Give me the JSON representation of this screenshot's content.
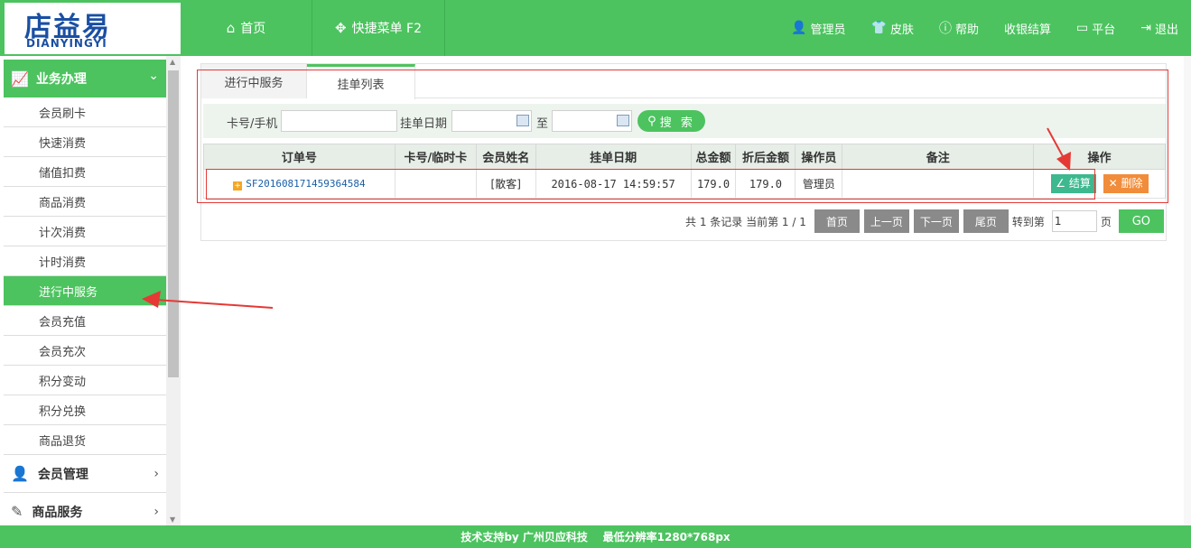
{
  "logo": {
    "main": "店益易",
    "sub": "DIANYINGYI"
  },
  "header": {
    "nav_left": [
      {
        "label": "首页",
        "icon": "home-icon"
      },
      {
        "label": "快捷菜单 F2",
        "icon": "move-icon"
      }
    ],
    "nav_right": [
      {
        "label": "管理员",
        "icon": "user-icon"
      },
      {
        "label": "皮肤",
        "icon": "tshirt-icon"
      },
      {
        "label": "帮助",
        "icon": "help-icon"
      },
      {
        "label": "收银结算",
        "icon": ""
      },
      {
        "label": "平台",
        "icon": "monitor-icon"
      },
      {
        "label": "退出",
        "icon": "logout-icon"
      }
    ]
  },
  "sidebar": {
    "section": "业务办理",
    "items": [
      "会员刷卡",
      "快速消费",
      "储值扣费",
      "商品消费",
      "计次消费",
      "计时消费",
      "进行中服务",
      "会员充值",
      "会员充次",
      "积分变动",
      "积分兑换",
      "商品退货"
    ],
    "active_index": 6,
    "groups": [
      "会员管理",
      "商品服务"
    ]
  },
  "tabs": [
    "进行中服务",
    "挂单列表"
  ],
  "search": {
    "card_label": "卡号/手机",
    "date_label": "挂单日期",
    "to_label": "至",
    "button": "搜 索"
  },
  "table": {
    "headers": [
      "订单号",
      "卡号/临时卡",
      "会员姓名",
      "挂单日期",
      "总金额",
      "折后金额",
      "操作员",
      "备注",
      "操作"
    ],
    "rows": [
      {
        "order": "SF20160817145936458​4",
        "card": "",
        "name": "[散客]",
        "date": "2016-08-17 14:59:57",
        "total": "179.0",
        "discount": "179.0",
        "operator": "管理员",
        "note": "",
        "settle": "结算",
        "delete": "删除"
      }
    ]
  },
  "pager": {
    "summary": "共 1 条记录 当前第 1 / 1",
    "first": "首页",
    "prev": "上一页",
    "next": "下一页",
    "last": "尾页",
    "goto_label": "转到第",
    "goto_value": "1",
    "page_label": "页",
    "go": "GO"
  },
  "footer": "技术支持by 广州贝应科技    最低分辨率1280*768px",
  "colors": {
    "brand_green": "#4cc35f",
    "settle": "#3db88f",
    "delete": "#f18c3a",
    "annotation": "#e53935"
  }
}
